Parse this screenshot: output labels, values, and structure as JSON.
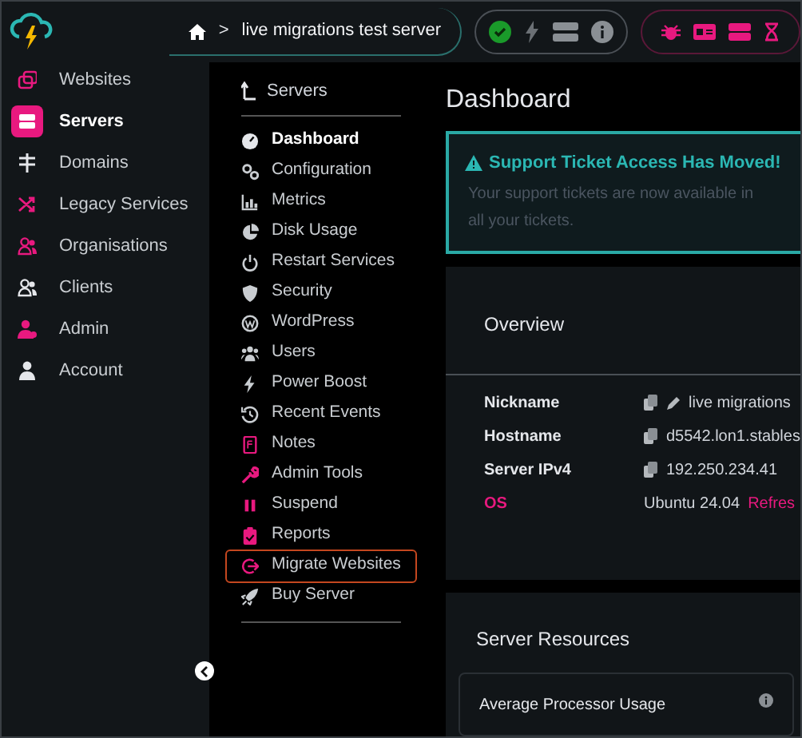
{
  "topbar": {
    "breadcrumb": {
      "separator": ">",
      "current": "live migrations test server"
    },
    "server_status": {
      "color": "#1a9a2a"
    }
  },
  "sidebar": {
    "items": [
      {
        "label": "Websites",
        "selected": false,
        "color": "#e8197f"
      },
      {
        "label": "Servers",
        "selected": true,
        "color": "#ffffff"
      },
      {
        "label": "Domains",
        "selected": false,
        "color": "#e5e7eb"
      },
      {
        "label": "Legacy Services",
        "selected": false,
        "color": "#e8197f"
      },
      {
        "label": "Organisations",
        "selected": false,
        "color": "#e8197f"
      },
      {
        "label": "Clients",
        "selected": false,
        "color": "#e5e7eb"
      },
      {
        "label": "Admin",
        "selected": false,
        "color": "#e8197f"
      },
      {
        "label": "Account",
        "selected": false,
        "color": "#e5e7eb"
      }
    ]
  },
  "subnav": {
    "back": "Servers",
    "items": [
      {
        "label": "Dashboard",
        "selected": true,
        "highlighted": false,
        "color": "#e5e7eb"
      },
      {
        "label": "Configuration",
        "selected": false,
        "highlighted": false,
        "color": "#c9cdd1"
      },
      {
        "label": "Metrics",
        "selected": false,
        "highlighted": false,
        "color": "#c9cdd1"
      },
      {
        "label": "Disk Usage",
        "selected": false,
        "highlighted": false,
        "color": "#c9cdd1"
      },
      {
        "label": "Restart Services",
        "selected": false,
        "highlighted": false,
        "color": "#c9cdd1"
      },
      {
        "label": "Security",
        "selected": false,
        "highlighted": false,
        "color": "#c9cdd1"
      },
      {
        "label": "WordPress",
        "selected": false,
        "highlighted": false,
        "color": "#c9cdd1"
      },
      {
        "label": "Users",
        "selected": false,
        "highlighted": false,
        "color": "#c9cdd1"
      },
      {
        "label": "Power Boost",
        "selected": false,
        "highlighted": false,
        "color": "#c9cdd1"
      },
      {
        "label": "Recent Events",
        "selected": false,
        "highlighted": false,
        "color": "#c9cdd1"
      },
      {
        "label": "Notes",
        "selected": false,
        "highlighted": false,
        "color": "#e8197f"
      },
      {
        "label": "Admin Tools",
        "selected": false,
        "highlighted": false,
        "color": "#e8197f"
      },
      {
        "label": "Suspend",
        "selected": false,
        "highlighted": false,
        "color": "#e8197f"
      },
      {
        "label": "Reports",
        "selected": false,
        "highlighted": false,
        "color": "#e8197f"
      },
      {
        "label": "Migrate Websites",
        "selected": false,
        "highlighted": true,
        "color": "#e8197f"
      },
      {
        "label": "Buy Server",
        "selected": false,
        "highlighted": false,
        "color": "#c9cdd1"
      }
    ]
  },
  "main": {
    "title": "Dashboard",
    "alert": {
      "title": "Support Ticket Access Has Moved!",
      "lines": [
        "Your support tickets are now available in",
        "all your tickets."
      ]
    },
    "overview": {
      "title": "Overview",
      "rows": [
        {
          "label": "Nickname",
          "value": "live migrations",
          "copy": true,
          "edit": true,
          "kind": "text"
        },
        {
          "label": "Hostname",
          "value": "d5542.lon1.stables",
          "copy": true,
          "edit": false,
          "kind": "text"
        },
        {
          "label": "Server IPv4",
          "value": "192.250.234.41",
          "copy": true,
          "edit": false,
          "kind": "text"
        },
        {
          "label": "OS",
          "value": "Ubuntu 24.04",
          "copy": false,
          "edit": false,
          "kind": "os",
          "link": "Refres"
        }
      ]
    },
    "resources": {
      "title": "Server Resources",
      "cards": [
        {
          "title": "Average Processor Usage"
        }
      ]
    }
  }
}
